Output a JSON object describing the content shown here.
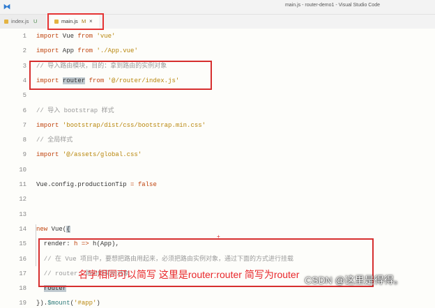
{
  "window": {
    "title": "main.js - router-demo1 - Visual Studio Code",
    "logo": "vscode-icon",
    "logo_glyph": "⧓"
  },
  "tabs": [
    {
      "label": "index.js",
      "status": "U",
      "icon": "js-file-icon"
    },
    {
      "label": "main.js",
      "status": "M",
      "close": "×",
      "icon": "js-file-icon"
    }
  ],
  "lines": [
    {
      "n": "1",
      "tokens": [
        {
          "t": "import",
          "c": "kw"
        },
        {
          "t": " Vue ",
          "c": "id"
        },
        {
          "t": "from",
          "c": "kw"
        },
        {
          "t": " ",
          "c": "id"
        },
        {
          "t": "'vue'",
          "c": "str"
        }
      ]
    },
    {
      "n": "2",
      "tokens": [
        {
          "t": "import",
          "c": "kw"
        },
        {
          "t": " App ",
          "c": "id"
        },
        {
          "t": "from",
          "c": "kw"
        },
        {
          "t": " ",
          "c": "id"
        },
        {
          "t": "'./App.vue'",
          "c": "str"
        }
      ]
    },
    {
      "n": "3",
      "tokens": [
        {
          "t": "// 导入路由模块，目的：拿到路由的实例对象",
          "c": "cm"
        }
      ]
    },
    {
      "n": "4",
      "tokens": [
        {
          "t": "import",
          "c": "kw"
        },
        {
          "t": " ",
          "c": "id"
        },
        {
          "t": "router",
          "c": "id hl"
        },
        {
          "t": " ",
          "c": "id"
        },
        {
          "t": "from",
          "c": "kw"
        },
        {
          "t": " ",
          "c": "id"
        },
        {
          "t": "'@/router/index.js'",
          "c": "str"
        }
      ]
    },
    {
      "n": "5",
      "tokens": []
    },
    {
      "n": "6",
      "tokens": [
        {
          "t": "// 导入 bootstrap 样式",
          "c": "cm"
        }
      ]
    },
    {
      "n": "7",
      "tokens": [
        {
          "t": "import",
          "c": "kw"
        },
        {
          "t": " ",
          "c": "id"
        },
        {
          "t": "'bootstrap/dist/css/bootstrap.min.css'",
          "c": "str"
        }
      ]
    },
    {
      "n": "8",
      "tokens": [
        {
          "t": "// 全局样式",
          "c": "cm"
        }
      ]
    },
    {
      "n": "9",
      "tokens": [
        {
          "t": "import",
          "c": "kw"
        },
        {
          "t": " ",
          "c": "id"
        },
        {
          "t": "'@/assets/global.css'",
          "c": "str"
        }
      ]
    },
    {
      "n": "10",
      "tokens": []
    },
    {
      "n": "11",
      "tokens": [
        {
          "t": "Vue.config.productionTip ",
          "c": "id"
        },
        {
          "t": "=",
          "c": "op"
        },
        {
          "t": " ",
          "c": "id"
        },
        {
          "t": "false",
          "c": "kw"
        }
      ]
    },
    {
      "n": "12",
      "tokens": []
    },
    {
      "n": "13",
      "tokens": []
    },
    {
      "n": "14",
      "tokens": [
        {
          "t": "new",
          "c": "kw"
        },
        {
          "t": " Vue(",
          "c": "id"
        },
        {
          "t": "{",
          "c": "id hl"
        }
      ]
    },
    {
      "n": "15",
      "tokens": [
        {
          "t": "  render: ",
          "c": "id"
        },
        {
          "t": "h",
          "c": "kw"
        },
        {
          "t": " ",
          "c": "id"
        },
        {
          "t": "=>",
          "c": "op"
        },
        {
          "t": " h(App),",
          "c": "id"
        }
      ]
    },
    {
      "n": "16",
      "tokens": [
        {
          "t": "  // 在 Vue 项目中，要想把路由用起来，必须把路由实例对象，通过下面的方式进行挂载",
          "c": "cm"
        }
      ]
    },
    {
      "n": "17",
      "tokens": [
        {
          "t": "  // router: 路由的实例对象",
          "c": "cm"
        }
      ]
    },
    {
      "n": "18",
      "tokens": [
        {
          "t": "  ",
          "c": "id"
        },
        {
          "t": "router",
          "c": "id hl"
        }
      ]
    },
    {
      "n": "19",
      "tokens": [
        {
          "t": "}).",
          "c": "id"
        },
        {
          "t": "$mount",
          "c": "fn"
        },
        {
          "t": "(",
          "c": "id"
        },
        {
          "t": "'#app'",
          "c": "str"
        },
        {
          "t": ")",
          "c": "id"
        }
      ]
    }
  ],
  "annotation": "名字相同可以简写 这里是router:router 简写为router",
  "watermark": "CSDN @这里是得得。",
  "cursor_glyph": "+",
  "colors": {
    "annotation": "#e8262a",
    "box": "#d62e2e",
    "keyword": "#c0440e",
    "string": "#b8860b",
    "comment": "#9a9a9a"
  }
}
